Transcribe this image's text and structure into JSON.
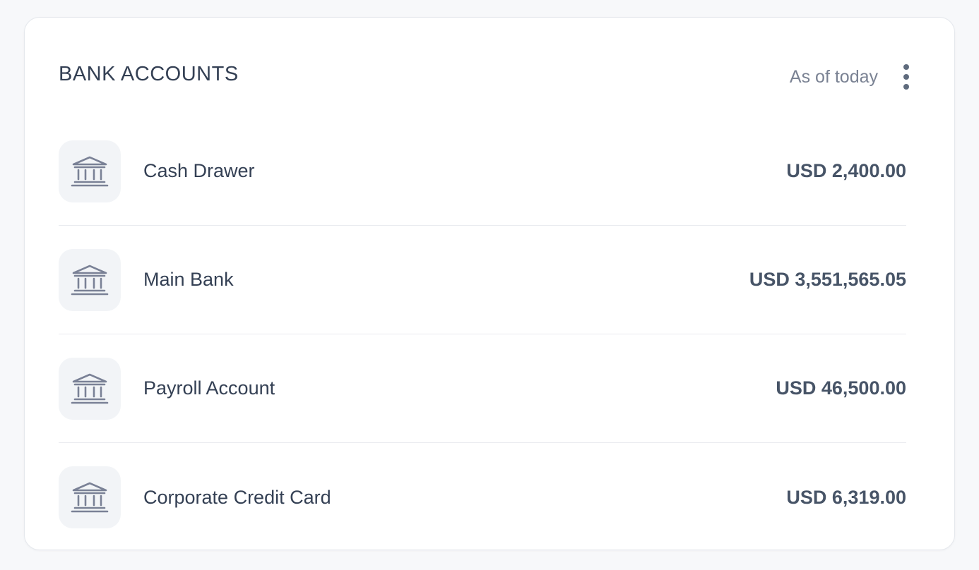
{
  "header": {
    "title": "BANK ACCOUNTS",
    "period": "As of today",
    "menu_icon": "kebab-menu-icon"
  },
  "accounts": [
    {
      "icon": "bank-icon",
      "name": "Cash Drawer",
      "balance": "USD 2,400.00"
    },
    {
      "icon": "bank-icon",
      "name": "Main Bank",
      "balance": "USD 3,551,565.05"
    },
    {
      "icon": "bank-icon",
      "name": "Payroll Account",
      "balance": "USD 46,500.00"
    },
    {
      "icon": "bank-icon",
      "name": "Corporate Credit Card",
      "balance": "USD 6,319.00"
    }
  ],
  "colors": {
    "page_background": "#f7f8fa",
    "card_background": "#ffffff",
    "icon_background": "#f2f4f7",
    "icon_stroke": "#7a8196",
    "title_text": "#344054",
    "muted_text": "#7a8293"
  }
}
